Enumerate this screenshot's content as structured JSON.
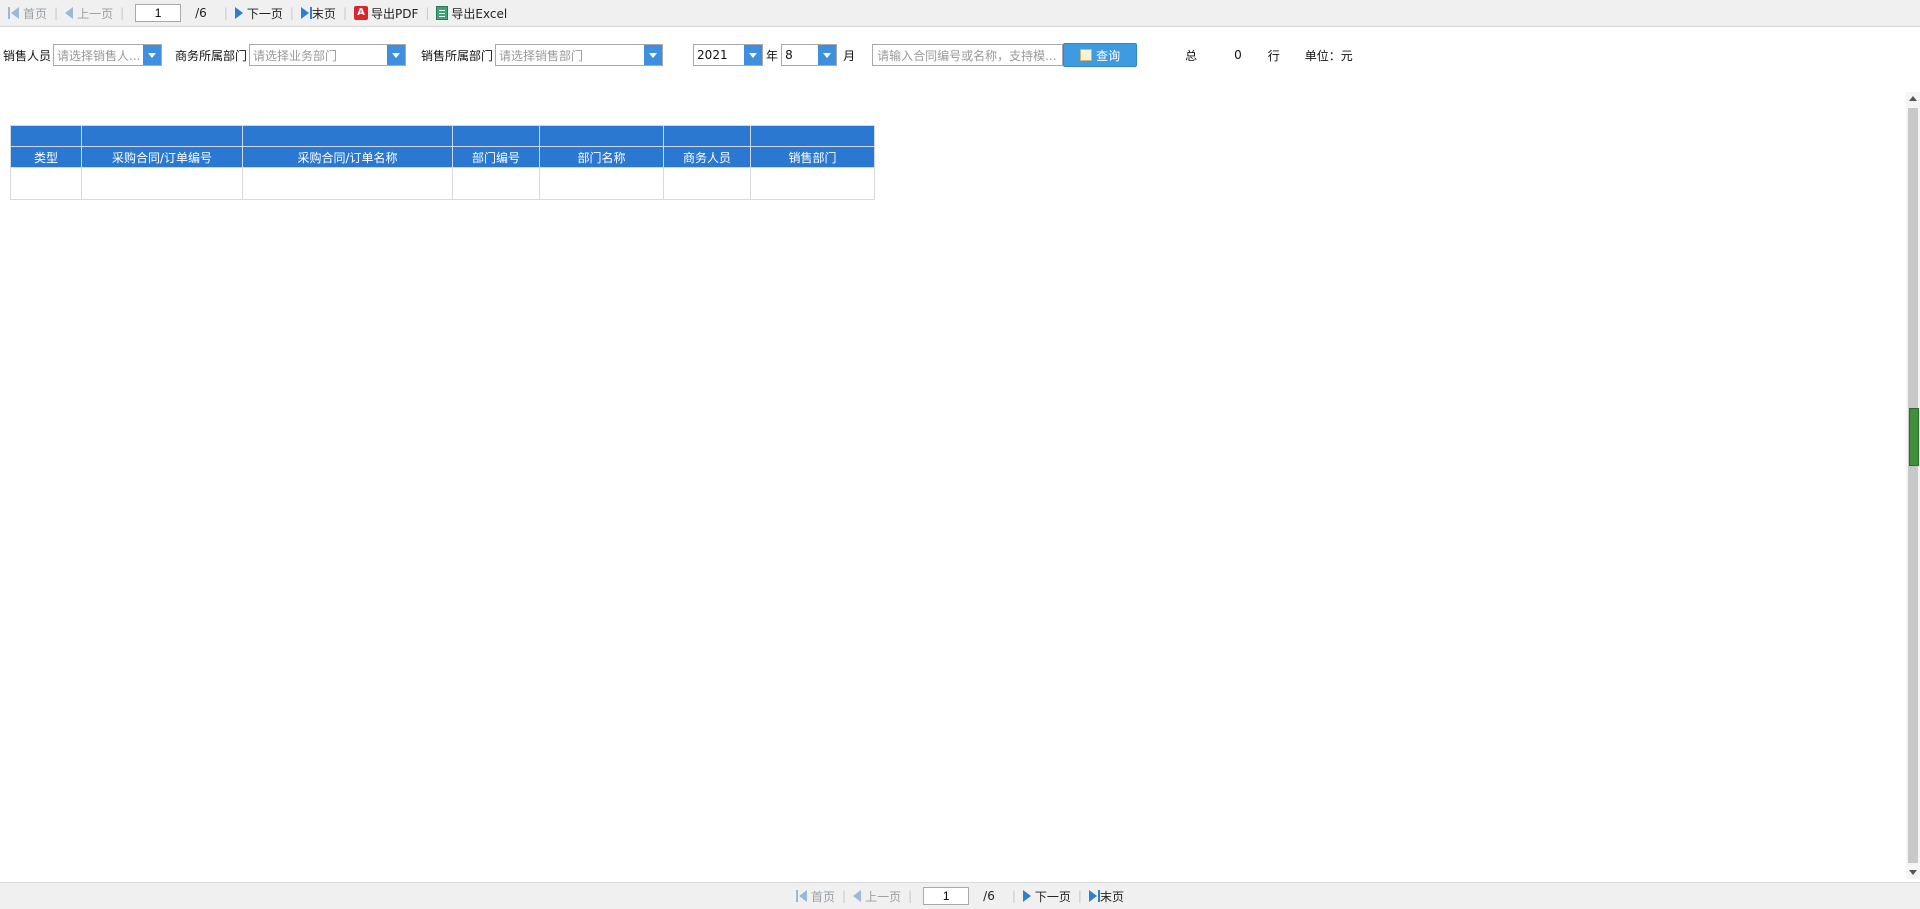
{
  "pager": {
    "first": "首页",
    "prev": "上一页",
    "page_value": "1",
    "total": "/6",
    "next": "下一页",
    "last": "末页",
    "export_pdf": "导出PDF",
    "export_excel": "导出Excel"
  },
  "filters": {
    "sales_person_label": "销售人员",
    "sales_person_placeholder": "请选择销售人...",
    "biz_dept_label": "商务所属部门",
    "biz_dept_placeholder": "请选择业务部门",
    "sales_dept_label": "销售所属部门",
    "sales_dept_placeholder": "请选择销售部门",
    "year_value": "2021",
    "year_label": "年",
    "month_value": "8",
    "month_label": "月",
    "search_placeholder": "请输入合同编号或名称，支持模...",
    "query_button": "查询"
  },
  "summary": {
    "total_label": "总",
    "count": "0",
    "row_label": "行",
    "unit": "单位：元"
  },
  "table": {
    "columns": [
      "类型",
      "采购合同/订单编号",
      "采购合同/订单名称",
      "部门编号",
      "部门名称",
      "商务人员",
      "销售部门"
    ]
  },
  "icons": {
    "first": "first-page-icon",
    "prev": "prev-page-icon",
    "next": "next-page-icon",
    "last": "last-page-icon",
    "pdf": "pdf-icon",
    "excel": "excel-icon",
    "query": "query-icon"
  },
  "colors": {
    "header_blue": "#2a78d2",
    "combo_arrow": "#3e8fdf",
    "query_button": "#3e9be0"
  }
}
